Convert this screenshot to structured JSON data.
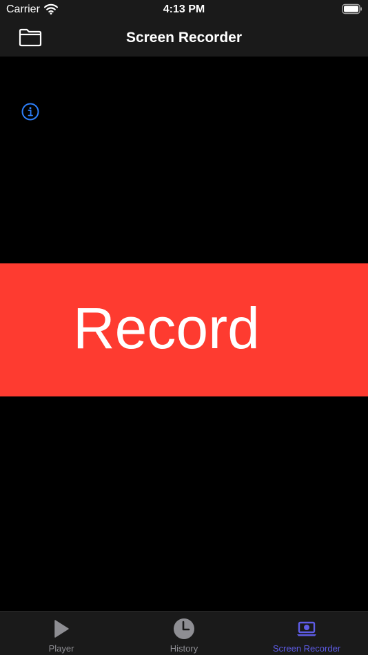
{
  "status_bar": {
    "carrier": "Carrier",
    "time": "4:13 PM"
  },
  "nav_bar": {
    "title": "Screen Recorder",
    "left_icon": "folder-icon"
  },
  "content": {
    "info_icon": "info-icon",
    "record_label": "Record"
  },
  "tab_bar": {
    "selected": "Screen Recorder",
    "tabs": [
      {
        "label": "Player",
        "icon": "play-icon"
      },
      {
        "label": "History",
        "icon": "clock-icon"
      },
      {
        "label": "Screen Recorder",
        "icon": "laptop-recorder-icon"
      }
    ]
  },
  "colors": {
    "record_red": "#fe3b30",
    "accent_blue": "#2d7ff9",
    "tab_active": "#5e5ce6",
    "tab_inactive": "#8e8e93",
    "bar_background": "#1a1a1a",
    "background": "#000000"
  }
}
